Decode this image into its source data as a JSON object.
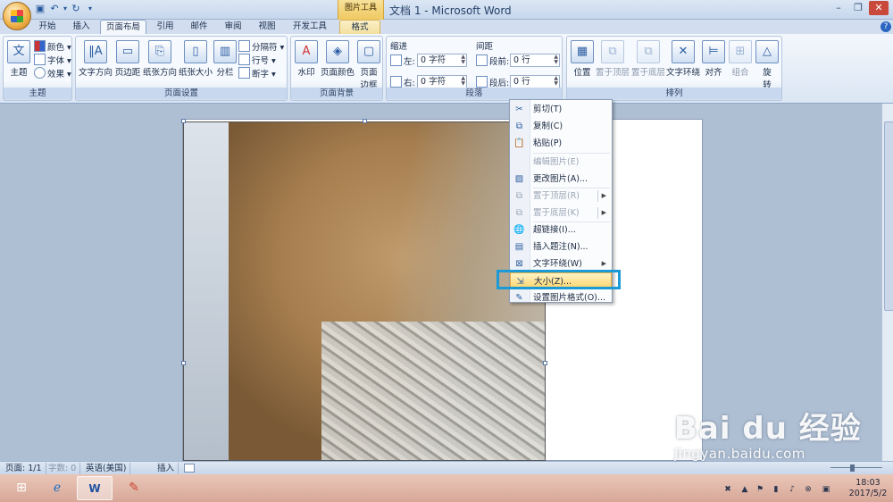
{
  "window": {
    "title": "文档 1 - Microsoft Word",
    "picture_tools": "图片工具",
    "controls": [
      "–",
      "❐",
      "✕"
    ]
  },
  "tabs": [
    "开始",
    "插入",
    "页面布局",
    "引用",
    "邮件",
    "审阅",
    "视图",
    "开发工具",
    "格式"
  ],
  "active_tab": "页面布局",
  "ribbon": {
    "theme_group": {
      "label": "主题",
      "theme_btn": "主题",
      "colors": "颜色",
      "fonts": "字体",
      "effects": "效果"
    },
    "page_setup": {
      "label": "页面设置",
      "text_direction": "文字方向",
      "margins": "页边距",
      "orientation": "纸张方向",
      "size": "纸张大小",
      "columns": "分栏",
      "breaks": "分隔符",
      "line_numbers": "行号",
      "hyphenation": "断字"
    },
    "page_background": {
      "label": "页面背景",
      "watermark": "水印",
      "page_color": "页面颜色",
      "page_borders_1": "页面",
      "page_borders_2": "边框"
    },
    "paragraph": {
      "label": "段落",
      "indent_header": "缩进",
      "spacing_header": "间距",
      "left_label": "左:",
      "left_value": "0 字符",
      "right_label": "右:",
      "right_value": "0 字符",
      "before_label": "段前:",
      "before_value": "0 行",
      "after_label": "段后:",
      "after_value": "0 行"
    },
    "arrange": {
      "label": "排列",
      "position": "位置",
      "bring_front": "置于顶层",
      "send_back": "置于底层",
      "text_wrap": "文字环绕",
      "align": "对齐",
      "group": "组合",
      "rotate_1": "旋",
      "rotate_2": "转"
    }
  },
  "context_menu": [
    {
      "label": "剪切(T)",
      "icon": "scissors-icon",
      "enabled": true
    },
    {
      "label": "复制(C)",
      "icon": "copy-icon",
      "enabled": true
    },
    {
      "label": "粘贴(P)",
      "icon": "paste-icon",
      "enabled": true
    },
    {
      "label": "编辑图片(E)",
      "icon": "",
      "enabled": false
    },
    {
      "label": "更改图片(A)...",
      "icon": "change-picture-icon",
      "enabled": true
    },
    {
      "label": "置于顶层(R)",
      "icon": "bring-front-icon",
      "enabled": false,
      "submenu": true
    },
    {
      "label": "置于底层(K)",
      "icon": "send-back-icon",
      "enabled": false,
      "submenu": true
    },
    {
      "label": "超链接(I)...",
      "icon": "hyperlink-icon",
      "enabled": true
    },
    {
      "label": "插入题注(N)...",
      "icon": "caption-icon",
      "enabled": true
    },
    {
      "label": "文字环绕(W)",
      "icon": "text-wrap-icon",
      "enabled": true,
      "submenu": true
    },
    {
      "label": "大小(Z)...",
      "icon": "size-icon",
      "enabled": true,
      "highlighted": true
    },
    {
      "label": "设置图片格式(O)...",
      "icon": "format-picture-icon",
      "enabled": true
    }
  ],
  "status": {
    "page": "页面: 1/1",
    "words": "字数: 0",
    "language": "英语(美国)",
    "mode": "插入"
  },
  "taskbar": {
    "time": "18:03",
    "date": "2017/5/2"
  },
  "watermark": {
    "brand": "Bai du 经验",
    "url": "jingyan.baidu.com"
  },
  "colors": {
    "highlight_box": "#1c9ad6",
    "menu_highlight": "#fcd46b"
  }
}
